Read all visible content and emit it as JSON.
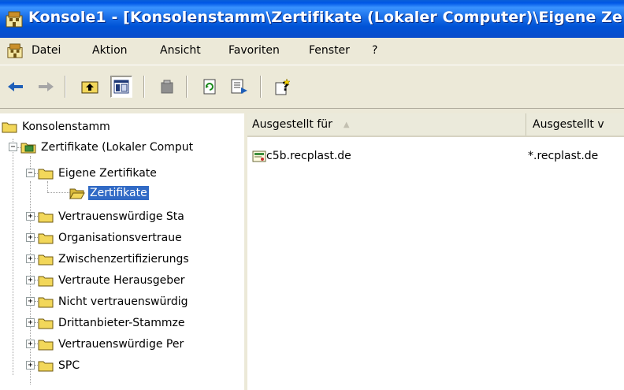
{
  "window": {
    "title": "Konsole1 - [Konsolenstamm\\Zertifikate (Lokaler Computer)\\Eigene Ze"
  },
  "menu": {
    "items": [
      "Datei",
      "Aktion",
      "Ansicht",
      "Favoriten",
      "Fenster",
      "?"
    ]
  },
  "toolbar": {
    "buttons": [
      "back-arrow-icon",
      "forward-arrow-icon",
      "up-folder-icon",
      "show-hide-tree-icon",
      "delete-icon",
      "refresh-icon",
      "export-list-icon",
      "help-icon"
    ]
  },
  "tree": {
    "root": "Konsolenstamm",
    "store": "Zertifikate (Lokaler Comput",
    "personal": "Eigene Zertifikate",
    "selected": "Zertifikate",
    "folders": [
      "Vertrauenswürdige Sta",
      "Organisationsvertraue",
      "Zwischenzertifizierungs",
      "Vertraute Herausgeber",
      "Nicht vertrauenswürdig",
      "Drittanbieter-Stammze",
      "Vertrauenswürdige Per",
      "SPC"
    ]
  },
  "list": {
    "columns": [
      "Ausgestellt für",
      "Ausgestellt v"
    ],
    "rows": [
      {
        "issued_to": "c5b.recplast.de",
        "issued_by": "*.recplast.de"
      }
    ]
  },
  "colors": {
    "title_bar": "#0053d6",
    "selection": "#316ac5",
    "folder": "#f2d75a"
  }
}
